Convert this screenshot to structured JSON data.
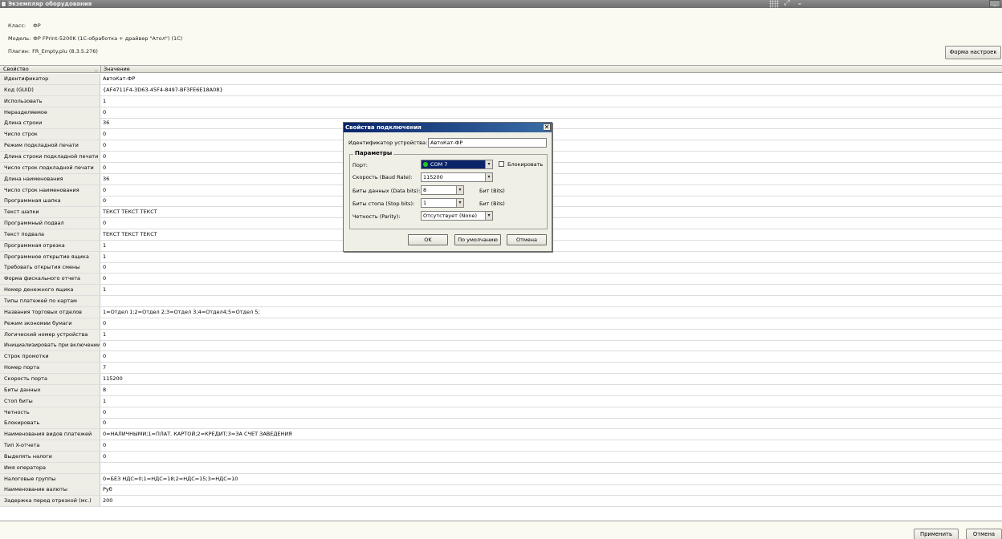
{
  "window": {
    "title": "Экземпляр оборудования"
  },
  "info": {
    "class_label": "Класс:",
    "class_value": "ФР",
    "model_label": "Модель:",
    "model_value": "ФР FPrint-5200K (1С-обработка + драйвер \"Атол\") (1С)",
    "plugin_label": "Плагин:",
    "plugin_value": "FR_Empty.plu (8.3.5.276)",
    "settings_button": "Форма настроек"
  },
  "table": {
    "col_property": "Свойство",
    "col_sort": "_",
    "col_value": "Значение",
    "rows": [
      {
        "name": "Идентификатор",
        "value": "АвтоКат-ФР"
      },
      {
        "name": "Код (GUID)",
        "value": "{AF4711F4-3D63-45F4-8497-BF3FE6E18A08}"
      },
      {
        "name": "Использовать",
        "value": "1"
      },
      {
        "name": "Неразделяемое",
        "value": "0"
      },
      {
        "name": "Длина строки",
        "value": "36"
      },
      {
        "name": "Число строк",
        "value": "0"
      },
      {
        "name": "Режим подкладной печати",
        "value": "0"
      },
      {
        "name": "Длина строки подкладной печати",
        "value": "0"
      },
      {
        "name": "Число строк подкладной печати",
        "value": "0"
      },
      {
        "name": "Длина наименования",
        "value": "36"
      },
      {
        "name": "Число строк наименования",
        "value": "0"
      },
      {
        "name": "Программная шапка",
        "value": "0"
      },
      {
        "name": "Текст шапки",
        "value": "ТЕКСТ ТЕКСТ ТЕКСТ"
      },
      {
        "name": "Программный подвал",
        "value": "0"
      },
      {
        "name": "Текст подвала",
        "value": "ТЕКСТ ТЕКСТ ТЕКСТ"
      },
      {
        "name": "Программная отрезка",
        "value": "1"
      },
      {
        "name": "Программное открытие ящика",
        "value": "1"
      },
      {
        "name": "Требовать открытия смены",
        "value": "0"
      },
      {
        "name": "Форма фискального отчета",
        "value": "0"
      },
      {
        "name": "Номер денежного ящика",
        "value": "1"
      },
      {
        "name": "Типы платежей по картам",
        "value": ""
      },
      {
        "name": "Названия торговых отделов",
        "value": "1=Отдел 1;2=Отдел 2;3=Отдел 3;4=Отдел4;5=Отдел 5;"
      },
      {
        "name": "Режим экономии бумаги",
        "value": "0"
      },
      {
        "name": "Логический номер устройства",
        "value": "1"
      },
      {
        "name": "Инициализировать при включении",
        "value": "0"
      },
      {
        "name": "Строк промотки",
        "value": "0"
      },
      {
        "name": "Номер порта",
        "value": "7"
      },
      {
        "name": "Скорость порта",
        "value": "115200"
      },
      {
        "name": "Биты данных",
        "value": "8"
      },
      {
        "name": "Стоп биты",
        "value": "1"
      },
      {
        "name": "Четность",
        "value": "0"
      },
      {
        "name": "Блокировать",
        "value": "0"
      },
      {
        "name": "Наименования видов платежей",
        "value": "0=НАЛИЧНЫМИ;1=ПЛАТ. КАРТОЙ;2=КРЕДИТ;3=ЗА СЧЕТ ЗАВЕДЕНИЯ"
      },
      {
        "name": "Тип X-отчета",
        "value": "0"
      },
      {
        "name": "Выделять налоги",
        "value": "0"
      },
      {
        "name": "Имя оператора",
        "value": ""
      },
      {
        "name": "Налоговые группы",
        "value": "0=БЕЗ НДС=0;1=НДС=18;2=НДС=15;3=НДС=10"
      },
      {
        "name": "Наименование валюты",
        "value": "Руб"
      },
      {
        "name": "Задержка перед отрезкой (мс.)",
        "value": "200"
      }
    ]
  },
  "bottom": {
    "apply_button": "Применить",
    "cancel_button": "Отмена"
  },
  "dialog": {
    "title": "Свойства подключения",
    "close_glyph": "✕",
    "device_id_label": "Идентификатор устройства:",
    "device_id_value": "АвтоКат-ФР",
    "params_group": "Параметры",
    "port_label": "Порт:",
    "port_value": "COM 7",
    "block_label": "Блокировать",
    "baud_label": "Скорость (Baud Rate):",
    "baud_value": "115200",
    "databits_label": "Биты данных (Data bits):",
    "databits_value": "8",
    "databits_unit": "Бит (Bits)",
    "stopbits_label": "Биты стопа (Stop bits):",
    "stopbits_value": "1",
    "stopbits_unit": "Бит (Bits)",
    "parity_label": "Четность (Parity):",
    "parity_value": "Отсутствует (None)",
    "ok_button": "OK",
    "default_button": "По умолчанию",
    "cancel_button": "Отмена"
  },
  "colors": {
    "dialog_title_start": "#0a246a",
    "dialog_title_end": "#3a6ea5",
    "port_indicator": "#23c823"
  }
}
